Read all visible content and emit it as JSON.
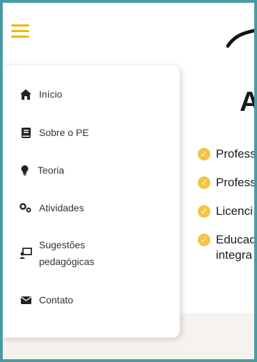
{
  "menu": {
    "items": [
      {
        "label": "Início",
        "icon": "home-icon"
      },
      {
        "label": "Sobre o PE",
        "icon": "book-icon"
      },
      {
        "label": "Teoria",
        "icon": "lightbulb-icon"
      },
      {
        "label": "Atividades",
        "icon": "cogs-icon"
      },
      {
        "label_line1": "Sugestões",
        "label_line2": "pedagógicas",
        "icon": "chalkboard-teacher-icon"
      },
      {
        "label": "Contato",
        "icon": "envelope-icon"
      }
    ]
  },
  "background": {
    "heading_fragment": "A",
    "list": [
      {
        "text": "Profess"
      },
      {
        "text": "Profess"
      },
      {
        "text": "Licenci"
      },
      {
        "text_line1": "Educad",
        "text_line2": "integra"
      }
    ]
  },
  "colors": {
    "frame": "#4a9aa3",
    "accent": "#f0b400",
    "check": "#f4c542"
  }
}
